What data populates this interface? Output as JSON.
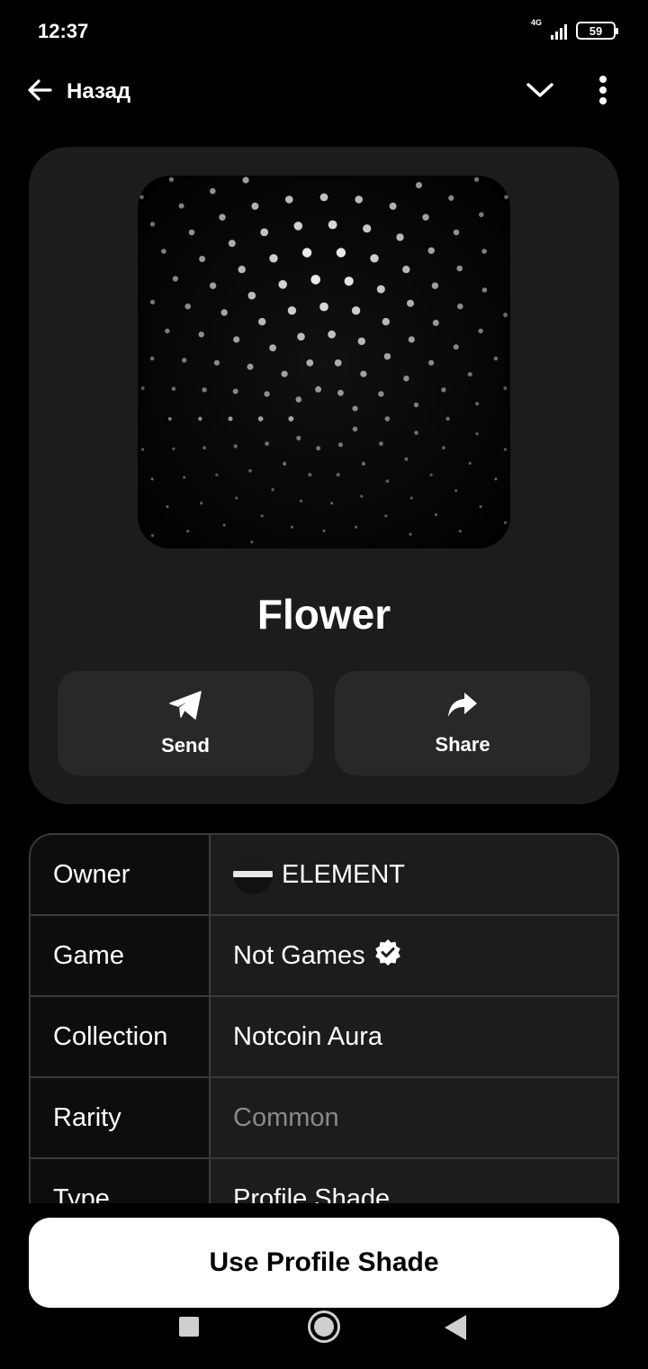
{
  "status_bar": {
    "time": "12:37",
    "network": "4G",
    "battery": "59",
    "icons": [
      "signal-icon",
      "battery-icon"
    ]
  },
  "header": {
    "back_label": "Назад",
    "icons": [
      "arrow-left-icon",
      "chevron-down-icon",
      "more-vertical-icon"
    ]
  },
  "item": {
    "title": "Flower",
    "artwork_icon": "dotted-flower-pattern"
  },
  "actions": [
    {
      "label": "Send",
      "icon": "send-plane-icon"
    },
    {
      "label": "Share",
      "icon": "share-arrow-icon"
    }
  ],
  "details": [
    {
      "key": "Owner",
      "value": "ELEMENT"
    },
    {
      "key": "Game",
      "value": "Not Games"
    },
    {
      "key": "Collection",
      "value": "Notcoin Aura"
    },
    {
      "key": "Rarity",
      "value": "Common"
    },
    {
      "key": "Type",
      "value": "Profile Shade"
    }
  ],
  "primary_action": {
    "label": "Use Profile Shade"
  },
  "nav_bar": {
    "icons": [
      "recent-apps-icon",
      "home-icon",
      "back-icon"
    ]
  },
  "colors": {
    "background": "#000000",
    "card": "#1c1c1c",
    "button": "#282828",
    "table_value_bg": "#1c1c1e",
    "table_key_bg": "#0d0d0d",
    "border": "#3a3a3a",
    "muted_text": "#8a8a8a",
    "primary_button": "#ffffff"
  }
}
